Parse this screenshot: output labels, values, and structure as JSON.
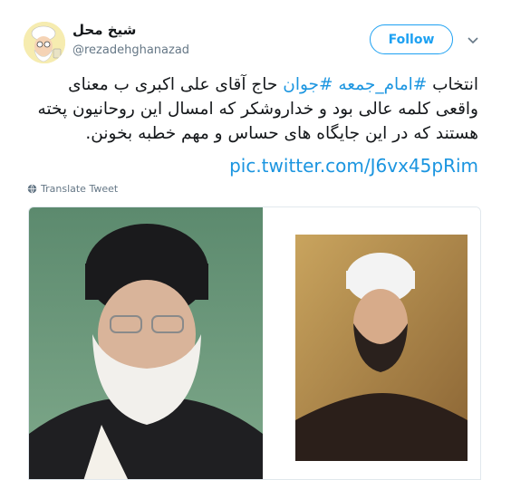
{
  "header": {
    "display_name": "شیخ محل",
    "handle": "@rezadehghanazad",
    "follow_label": "Follow"
  },
  "tweet": {
    "prefix": "انتخاب ",
    "hashtag_1": "#امام_جمعه",
    "space": " ",
    "hashtag_2": "#جوان",
    "rest": " حاج آقای علی اکبری ب معنای واقعی کلمه عالی بود و خداروشکر که امسال این روحانیون پخته هستند که در این جایگاه های حساس و مهم خطبه بخونن.",
    "pic_link": "pic.twitter.com/J6vx45pRim",
    "translate_label": "Translate Tweet"
  },
  "icons": {
    "avatar": "cartoon-sheikh-avatar",
    "caret": "chevron-down-icon",
    "translate": "globe-icon"
  },
  "colors": {
    "accent": "#1da1f2",
    "link": "#1b95e0",
    "text": "#14171a",
    "muted": "#657786"
  }
}
